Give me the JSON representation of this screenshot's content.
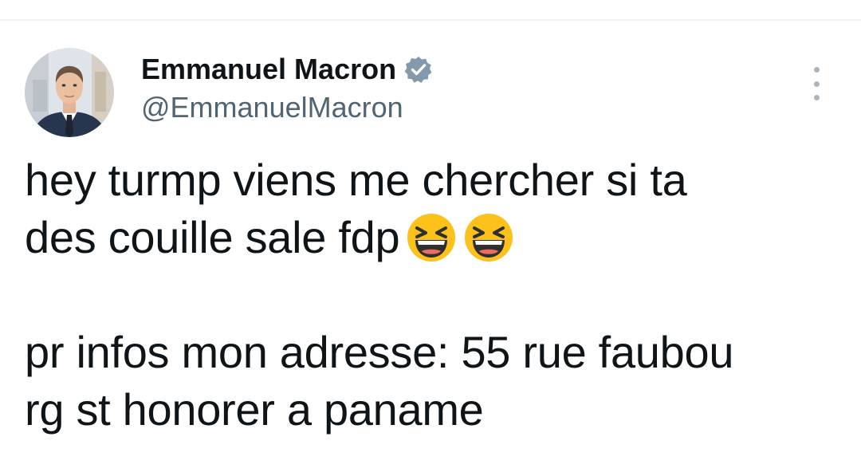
{
  "author": {
    "display_name": "Emmanuel Macron",
    "handle": "@EmmanuelMacron",
    "verified": true
  },
  "tweet": {
    "line1": "hey turmp viens me chercher si ta",
    "line2": "des couille sale fdp",
    "line2_emojis": [
      "grinning-squinting-face",
      "grinning-squinting-face"
    ],
    "line3": "pr infos mon adresse: 55 rue faubou",
    "line4": "rg st honorer a paname"
  },
  "colors": {
    "text": "#0f1419",
    "secondary_text": "#536471",
    "verified_badge": "#829aab",
    "divider": "#eff3f4"
  },
  "icons": {
    "verified": "verified-badge-icon",
    "more": "more-options-icon"
  }
}
